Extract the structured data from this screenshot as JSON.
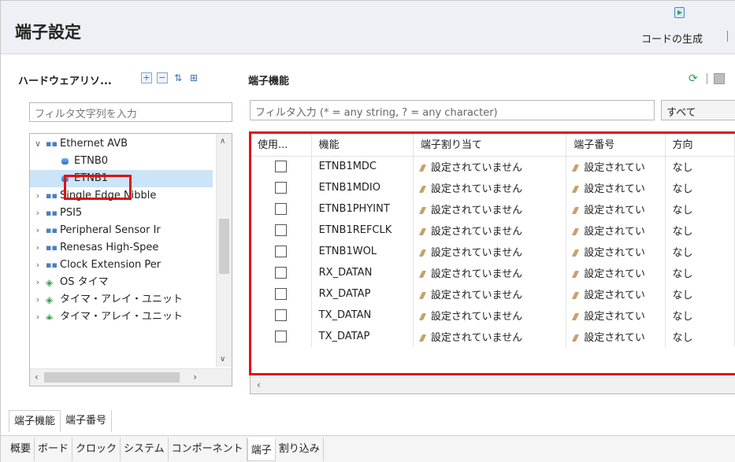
{
  "window": {
    "title": "端子設定",
    "code_gen_label": "コードの生成"
  },
  "left_panel": {
    "title": "ハードウェアリソ...",
    "filter_placeholder": "フィルタ文字列を入力",
    "tree": [
      {
        "label": "Ethernet AVB",
        "expanded": true,
        "icon": "peripheral-icon"
      },
      {
        "label": "ETNB0",
        "icon": "module-icon"
      },
      {
        "label": "ETNB1",
        "icon": "module-icon",
        "selected": true
      },
      {
        "label": "Single Edge Nibble",
        "icon": "peripheral-icon"
      },
      {
        "label": "PSI5",
        "icon": "peripheral-icon"
      },
      {
        "label": "Peripheral Sensor Ir",
        "icon": "peripheral-icon"
      },
      {
        "label": "Renesas High-Spee",
        "icon": "peripheral-icon"
      },
      {
        "label": "Clock Extension Per",
        "icon": "peripheral-icon"
      },
      {
        "label": "OS タイマ",
        "icon": "timer-icon"
      },
      {
        "label": "タイマ・アレイ・ユニット",
        "icon": "timer-icon"
      },
      {
        "label": "タイマ・アレイ・ユニット",
        "icon": "timer-icon"
      }
    ]
  },
  "right_panel": {
    "title": "端子機能",
    "filter_placeholder": "フィルタ入力 (* = any string, ? = any character)",
    "filter_select": "すべて",
    "columns": [
      "使用...",
      "機能",
      "端子割り当て",
      "端子番号",
      "方向"
    ],
    "rows": [
      {
        "function": "ETNB1MDC",
        "assign": "設定されていません",
        "pin": "設定されてい",
        "dir": "なし"
      },
      {
        "function": "ETNB1MDIO",
        "assign": "設定されていません",
        "pin": "設定されてい",
        "dir": "なし"
      },
      {
        "function": "ETNB1PHYINT",
        "assign": "設定されていません",
        "pin": "設定されてい",
        "dir": "なし"
      },
      {
        "function": "ETNB1REFCLK",
        "assign": "設定されていません",
        "pin": "設定されてい",
        "dir": "なし"
      },
      {
        "function": "ETNB1WOL",
        "assign": "設定されていません",
        "pin": "設定されてい",
        "dir": "なし"
      },
      {
        "function": "RX_DATAN",
        "assign": "設定されていません",
        "pin": "設定されてい",
        "dir": "なし"
      },
      {
        "function": "RX_DATAP",
        "assign": "設定されていません",
        "pin": "設定されてい",
        "dir": "なし"
      },
      {
        "function": "TX_DATAN",
        "assign": "設定されていません",
        "pin": "設定されてい",
        "dir": "なし"
      },
      {
        "function": "TX_DATAP",
        "assign": "設定されていません",
        "pin": "設定されてい",
        "dir": "なし"
      }
    ]
  },
  "bottom_tabs": [
    "端子機能",
    "端子番号"
  ],
  "sheet_tabs": [
    "概要",
    "ボード",
    "クロック",
    "システム",
    "コンポーネント",
    "端子",
    "割り込み"
  ],
  "active_sheet_tab": "端子",
  "highlight_color": "#e01010"
}
